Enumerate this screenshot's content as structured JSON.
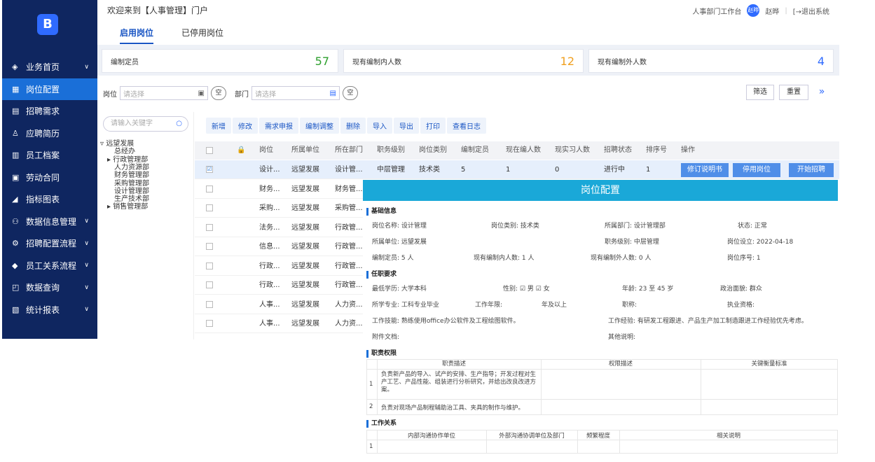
{
  "app": {
    "logo_glyph": "B"
  },
  "sidebar": {
    "items": [
      {
        "label": "业务首页",
        "icon": "layers-icon",
        "chev": "∨"
      },
      {
        "label": "岗位配置",
        "icon": "grid-icon"
      },
      {
        "label": "招聘需求",
        "icon": "clipboard-icon"
      },
      {
        "label": "应聘简历",
        "icon": "user-icon"
      },
      {
        "label": "员工档案",
        "icon": "book-icon"
      },
      {
        "label": "劳动合同",
        "icon": "document-icon"
      },
      {
        "label": "指标图表",
        "icon": "chart-icon"
      },
      {
        "label": "数据信息管理",
        "icon": "person-settings-icon",
        "chev": "∨"
      },
      {
        "label": "招聘配置流程",
        "icon": "flow-icon",
        "chev": "∨"
      },
      {
        "label": "员工关系流程",
        "icon": "diamond-icon",
        "chev": "∨"
      },
      {
        "label": "数据查询",
        "icon": "search-box-icon",
        "chev": "∨"
      },
      {
        "label": "统计报表",
        "icon": "report-icon",
        "chev": "∨"
      }
    ]
  },
  "header": {
    "welcome": "欢迎来到【人事管理】门户",
    "tabs": [
      "启用岗位",
      "已停用岗位"
    ],
    "workbench": "人事部门工作台",
    "avatar_text": "赵晔",
    "user": "赵晔",
    "sep": "|",
    "logout": "[→退出系统"
  },
  "stats": [
    {
      "label": "编制定员",
      "value": "57",
      "color": "#2ea02e"
    },
    {
      "label": "现有编制内人数",
      "value": "12",
      "color": "#f0a020"
    },
    {
      "label": "现有编制外人数",
      "value": "4",
      "color": "#2f6bff"
    }
  ],
  "filter": {
    "post_label": "岗位",
    "post_placeholder": "请选择",
    "dept_label": "部门",
    "dept_placeholder": "请选择",
    "clear": "空",
    "filter_btn": "筛选",
    "reset_btn": "重置",
    "expand": "»"
  },
  "tree": {
    "search_placeholder": "请输入关键字",
    "nodes": [
      {
        "label": "▿ 远望发展",
        "indent": 0
      },
      {
        "label": "总经办",
        "indent": 2
      },
      {
        "label": "▸ 行政管理部",
        "indent": 1
      },
      {
        "label": "人力资源部",
        "indent": 2
      },
      {
        "label": "财务管理部",
        "indent": 2
      },
      {
        "label": "采购管理部",
        "indent": 2
      },
      {
        "label": "设计管理部",
        "indent": 2
      },
      {
        "label": "生产技术部",
        "indent": 2
      },
      {
        "label": "▸ 销售管理部",
        "indent": 1
      }
    ]
  },
  "toolbar": [
    "新增",
    "修改",
    "需求申报",
    "编制调整",
    "删除",
    "导入",
    "导出",
    "打印",
    "查看日志"
  ],
  "table": {
    "headers": [
      "岗位",
      "所属单位",
      "所在部门",
      "职务级别",
      "岗位类别",
      "编制定员",
      "现在编人数",
      "现实习人数",
      "招聘状态",
      "排序号",
      "操作"
    ],
    "lock_glyph": "🔒",
    "rows": [
      {
        "check": "☑",
        "c": [
          "设计...",
          "远望发展",
          "设计管...",
          "中层管理",
          "技术类",
          "5",
          "1",
          "0",
          "进行中",
          "1"
        ],
        "actions": [
          "修订说明书",
          "停用岗位",
          "开始招聘"
        ]
      },
      {
        "check": "",
        "c": [
          "财务...",
          "远望发展",
          "财务管..."
        ]
      },
      {
        "check": "",
        "c": [
          "采购...",
          "远望发展",
          "采购管..."
        ]
      },
      {
        "check": "",
        "c": [
          "法务...",
          "远望发展",
          "行政管..."
        ]
      },
      {
        "check": "",
        "c": [
          "信息...",
          "远望发展",
          "行政管..."
        ]
      },
      {
        "check": "",
        "c": [
          "行政...",
          "远望发展",
          "行政管..."
        ]
      },
      {
        "check": "",
        "c": [
          "行政...",
          "远望发展",
          "行政管..."
        ]
      },
      {
        "check": "",
        "c": [
          "人事...",
          "远望发展",
          "人力资..."
        ]
      },
      {
        "check": "",
        "c": [
          "人事...",
          "远望发展",
          "人力资..."
        ]
      }
    ]
  },
  "panel": {
    "title": "岗位配置",
    "sec_basic": "基础信息",
    "basic": [
      "岗位名称: 设计管理",
      "岗位类别: 技术类",
      "所属部门: 设计管理部",
      "状态: 正常",
      "所属单位: 远望发展",
      "职务级别: 中层管理",
      "岗位设立: 2022-04-18",
      "编制定员:   5   人",
      "现有编制内人数:   1   人",
      "现有编制外人数:   0   人",
      "岗位序号: 1"
    ],
    "sec_req": "任职要求",
    "req": [
      "最低学历: 大学本科",
      "性别: ☑ 男   ☑ 女",
      "年龄:   23   至   45   岁",
      "政治面貌: 群众",
      "所学专业: 工科专业毕业",
      "工作年限:",
      "年及以上",
      "职称:",
      "执业资格:",
      "工作技能: 熟练使用office办公软件及工程绘图软件。",
      "工作经验: 有研发工程跟进、产品生产加工制造跟进工作经验优先考虑。",
      "附件文档:",
      "其他说明:"
    ],
    "sec_duty": "职责权限",
    "duty_headers": [
      "职责描述",
      "权限描述",
      "关键衡量标准"
    ],
    "duty_rows": [
      {
        "n": "1",
        "desc": "负责新产品的导入、试产的安排、生产指导；开发过程对生产工艺、产品性能、组装进行分析研究，并给出改良改进方案。"
      },
      {
        "n": "2",
        "desc": "负责对现场产品制程辅助治工具、夹具的制作与维护。"
      }
    ],
    "sec_rel": "工作关系",
    "rel_headers": [
      "内部沟通协作单位",
      "外部沟通协调单位及部门",
      "频繁程度",
      "相关说明"
    ],
    "rel_rows": [
      {
        "n": "1"
      }
    ]
  }
}
